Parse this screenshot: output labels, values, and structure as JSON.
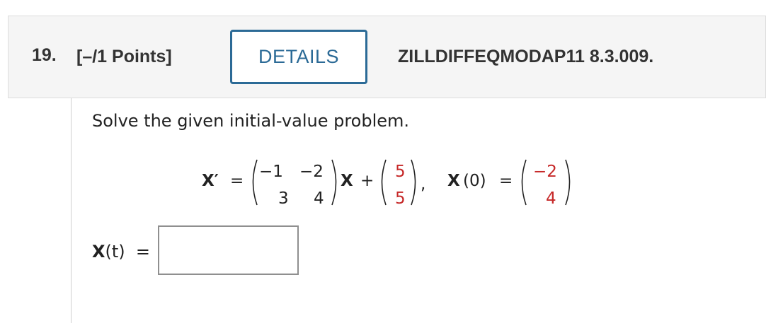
{
  "question": {
    "number": "19.",
    "points": "[–/1 Points]",
    "details_label": "DETAILS",
    "problem_id": "ZILLDIFFEQMODAP11 8.3.009."
  },
  "instruction": "Solve the given initial-value problem.",
  "equation": {
    "lhs": "X′",
    "equals": "=",
    "matrix_a": [
      "−1",
      "−2",
      "3",
      "4"
    ],
    "x_symbol": "X",
    "plus": "+",
    "vector_f": [
      "5",
      "5"
    ],
    "comma": ",",
    "ic_symbol": "X",
    "ic_arg": "(0)",
    "ic_equals": "=",
    "vector_x0": [
      "−2",
      "4"
    ],
    "highlight_color": "#c62828"
  },
  "answer": {
    "label_symbol": "X",
    "label_arg": "(t)",
    "label_equals": "=",
    "value": "",
    "placeholder": ""
  }
}
